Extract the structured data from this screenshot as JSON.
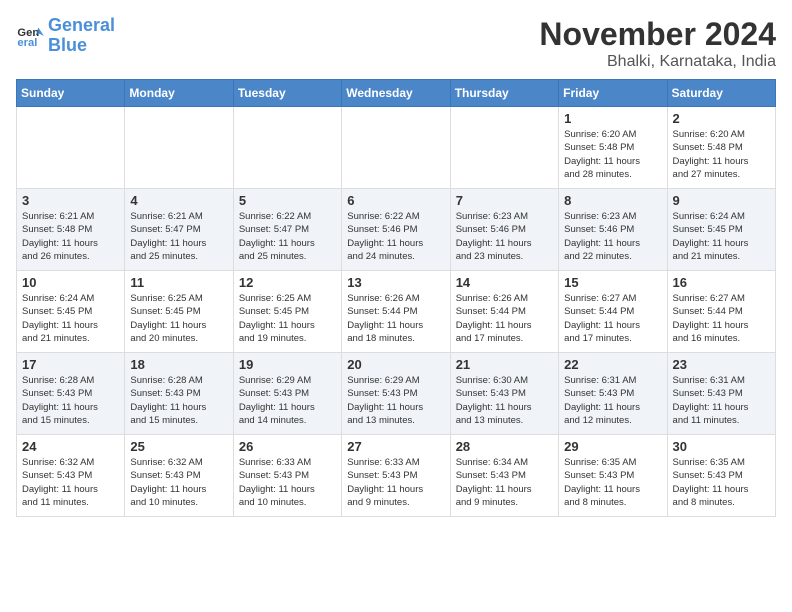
{
  "logo": {
    "line1": "General",
    "line2": "Blue"
  },
  "title": "November 2024",
  "location": "Bhalki, Karnataka, India",
  "days_header": [
    "Sunday",
    "Monday",
    "Tuesday",
    "Wednesday",
    "Thursday",
    "Friday",
    "Saturday"
  ],
  "weeks": [
    [
      {
        "day": "",
        "info": ""
      },
      {
        "day": "",
        "info": ""
      },
      {
        "day": "",
        "info": ""
      },
      {
        "day": "",
        "info": ""
      },
      {
        "day": "",
        "info": ""
      },
      {
        "day": "1",
        "info": "Sunrise: 6:20 AM\nSunset: 5:48 PM\nDaylight: 11 hours\nand 28 minutes."
      },
      {
        "day": "2",
        "info": "Sunrise: 6:20 AM\nSunset: 5:48 PM\nDaylight: 11 hours\nand 27 minutes."
      }
    ],
    [
      {
        "day": "3",
        "info": "Sunrise: 6:21 AM\nSunset: 5:48 PM\nDaylight: 11 hours\nand 26 minutes."
      },
      {
        "day": "4",
        "info": "Sunrise: 6:21 AM\nSunset: 5:47 PM\nDaylight: 11 hours\nand 25 minutes."
      },
      {
        "day": "5",
        "info": "Sunrise: 6:22 AM\nSunset: 5:47 PM\nDaylight: 11 hours\nand 25 minutes."
      },
      {
        "day": "6",
        "info": "Sunrise: 6:22 AM\nSunset: 5:46 PM\nDaylight: 11 hours\nand 24 minutes."
      },
      {
        "day": "7",
        "info": "Sunrise: 6:23 AM\nSunset: 5:46 PM\nDaylight: 11 hours\nand 23 minutes."
      },
      {
        "day": "8",
        "info": "Sunrise: 6:23 AM\nSunset: 5:46 PM\nDaylight: 11 hours\nand 22 minutes."
      },
      {
        "day": "9",
        "info": "Sunrise: 6:24 AM\nSunset: 5:45 PM\nDaylight: 11 hours\nand 21 minutes."
      }
    ],
    [
      {
        "day": "10",
        "info": "Sunrise: 6:24 AM\nSunset: 5:45 PM\nDaylight: 11 hours\nand 21 minutes."
      },
      {
        "day": "11",
        "info": "Sunrise: 6:25 AM\nSunset: 5:45 PM\nDaylight: 11 hours\nand 20 minutes."
      },
      {
        "day": "12",
        "info": "Sunrise: 6:25 AM\nSunset: 5:45 PM\nDaylight: 11 hours\nand 19 minutes."
      },
      {
        "day": "13",
        "info": "Sunrise: 6:26 AM\nSunset: 5:44 PM\nDaylight: 11 hours\nand 18 minutes."
      },
      {
        "day": "14",
        "info": "Sunrise: 6:26 AM\nSunset: 5:44 PM\nDaylight: 11 hours\nand 17 minutes."
      },
      {
        "day": "15",
        "info": "Sunrise: 6:27 AM\nSunset: 5:44 PM\nDaylight: 11 hours\nand 17 minutes."
      },
      {
        "day": "16",
        "info": "Sunrise: 6:27 AM\nSunset: 5:44 PM\nDaylight: 11 hours\nand 16 minutes."
      }
    ],
    [
      {
        "day": "17",
        "info": "Sunrise: 6:28 AM\nSunset: 5:43 PM\nDaylight: 11 hours\nand 15 minutes."
      },
      {
        "day": "18",
        "info": "Sunrise: 6:28 AM\nSunset: 5:43 PM\nDaylight: 11 hours\nand 15 minutes."
      },
      {
        "day": "19",
        "info": "Sunrise: 6:29 AM\nSunset: 5:43 PM\nDaylight: 11 hours\nand 14 minutes."
      },
      {
        "day": "20",
        "info": "Sunrise: 6:29 AM\nSunset: 5:43 PM\nDaylight: 11 hours\nand 13 minutes."
      },
      {
        "day": "21",
        "info": "Sunrise: 6:30 AM\nSunset: 5:43 PM\nDaylight: 11 hours\nand 13 minutes."
      },
      {
        "day": "22",
        "info": "Sunrise: 6:31 AM\nSunset: 5:43 PM\nDaylight: 11 hours\nand 12 minutes."
      },
      {
        "day": "23",
        "info": "Sunrise: 6:31 AM\nSunset: 5:43 PM\nDaylight: 11 hours\nand 11 minutes."
      }
    ],
    [
      {
        "day": "24",
        "info": "Sunrise: 6:32 AM\nSunset: 5:43 PM\nDaylight: 11 hours\nand 11 minutes."
      },
      {
        "day": "25",
        "info": "Sunrise: 6:32 AM\nSunset: 5:43 PM\nDaylight: 11 hours\nand 10 minutes."
      },
      {
        "day": "26",
        "info": "Sunrise: 6:33 AM\nSunset: 5:43 PM\nDaylight: 11 hours\nand 10 minutes."
      },
      {
        "day": "27",
        "info": "Sunrise: 6:33 AM\nSunset: 5:43 PM\nDaylight: 11 hours\nand 9 minutes."
      },
      {
        "day": "28",
        "info": "Sunrise: 6:34 AM\nSunset: 5:43 PM\nDaylight: 11 hours\nand 9 minutes."
      },
      {
        "day": "29",
        "info": "Sunrise: 6:35 AM\nSunset: 5:43 PM\nDaylight: 11 hours\nand 8 minutes."
      },
      {
        "day": "30",
        "info": "Sunrise: 6:35 AM\nSunset: 5:43 PM\nDaylight: 11 hours\nand 8 minutes."
      }
    ]
  ]
}
